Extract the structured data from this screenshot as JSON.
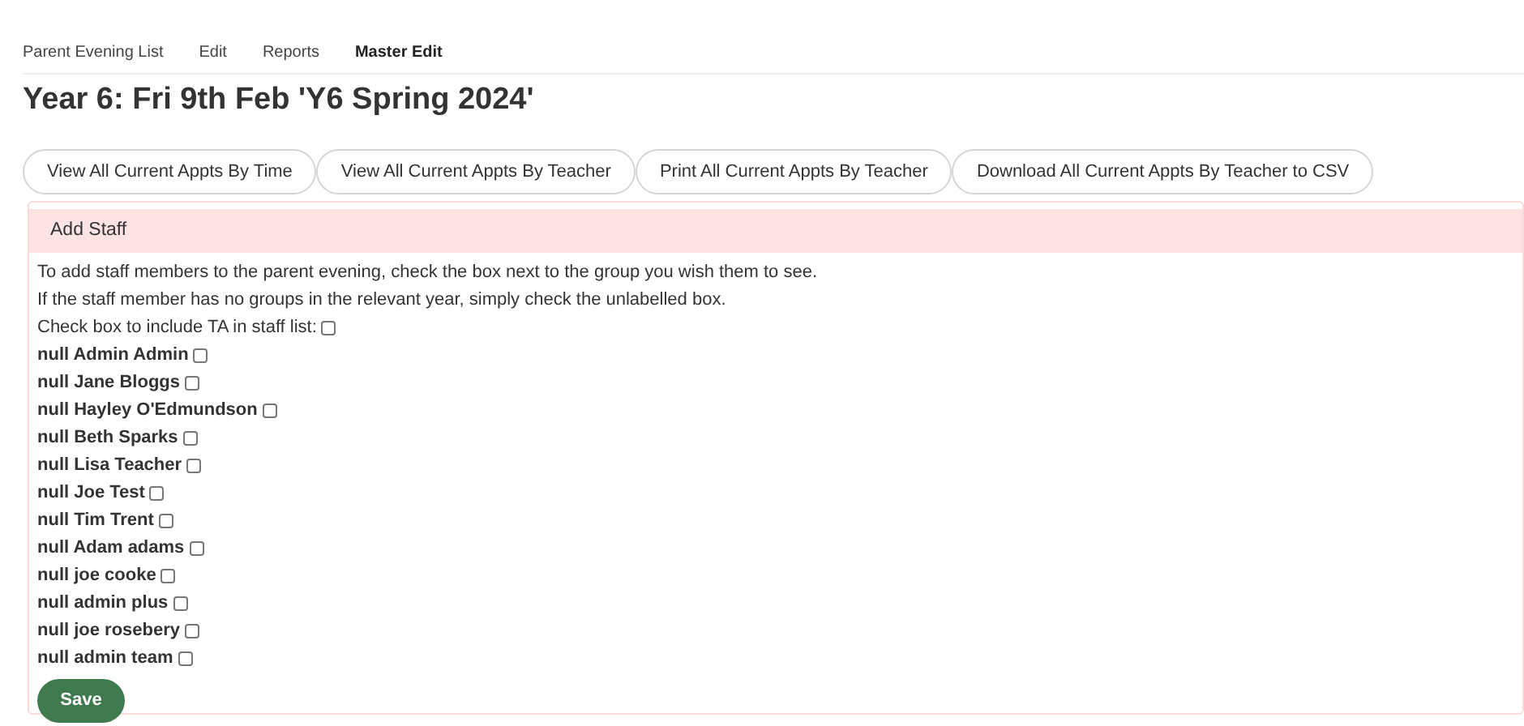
{
  "nav": [
    {
      "label": "Parent Evening List",
      "selected": false
    },
    {
      "label": "Edit",
      "selected": false
    },
    {
      "label": "Reports",
      "selected": false
    },
    {
      "label": "Master Edit",
      "selected": true
    }
  ],
  "title": "Year 6: Fri 9th Feb 'Y6 Spring 2024'",
  "buttons": [
    "View All Current Appts By Time",
    "View All Current Appts By Teacher",
    "Print All Current Appts By Teacher",
    "Download All Current Appts By Teacher to CSV"
  ],
  "panel": {
    "heading": "Add Staff",
    "instructions": [
      "To add staff members to the parent evening, check the box next to the group you wish them to see.",
      "If the staff member has no groups in the relevant year, simply check the unlabelled box."
    ],
    "ta_option": {
      "label": "Check box to include TA in staff list:",
      "checked": false
    },
    "staff": [
      {
        "name": "null Admin Admin",
        "checked": false
      },
      {
        "name": "null Jane Bloggs",
        "checked": false
      },
      {
        "name": "null Hayley O'Edmundson",
        "checked": false
      },
      {
        "name": "null Beth Sparks",
        "checked": false
      },
      {
        "name": "null Lisa Teacher",
        "checked": false
      },
      {
        "name": "null Joe Test",
        "checked": false
      },
      {
        "name": "null Tim Trent",
        "checked": false
      },
      {
        "name": "null Adam adams",
        "checked": false
      },
      {
        "name": "null joe cooke",
        "checked": false
      },
      {
        "name": "null admin plus",
        "checked": false
      },
      {
        "name": "null joe rosebery",
        "checked": false
      },
      {
        "name": "null admin team",
        "checked": false
      }
    ],
    "save_button": "Save"
  }
}
